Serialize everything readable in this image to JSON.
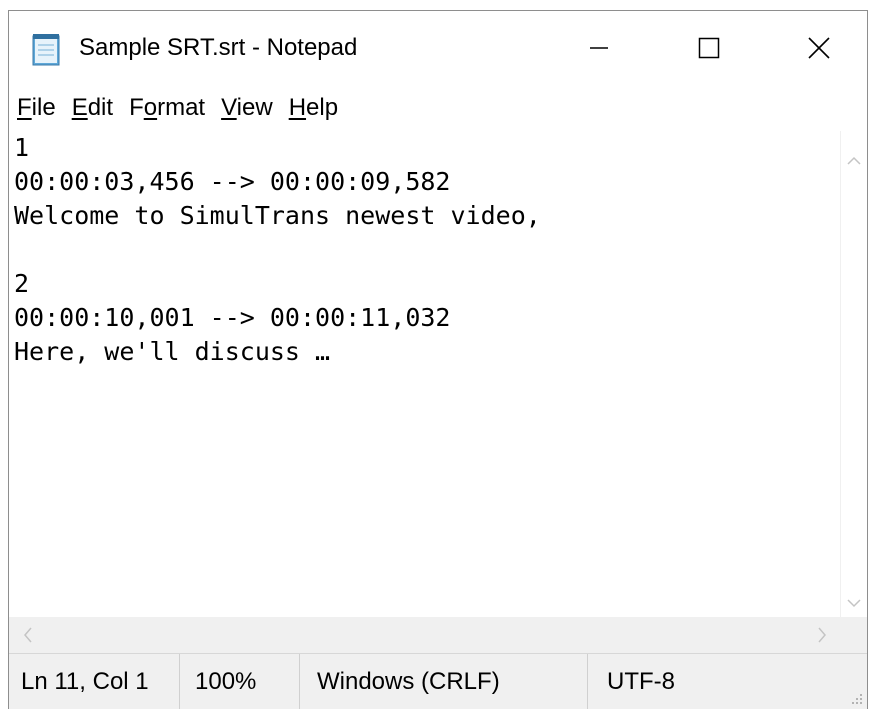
{
  "window": {
    "title": "Sample SRT.srt - Notepad",
    "icon": "notepad-icon",
    "controls": [
      "minimize-icon",
      "maximize-icon",
      "close-icon"
    ]
  },
  "menu": {
    "items": [
      {
        "accel": "F",
        "rest": "ile"
      },
      {
        "accel": "E",
        "rest": "dit"
      },
      {
        "pre": "F",
        "accel": "o",
        "rest": "rmat"
      },
      {
        "accel": "V",
        "rest": "iew"
      },
      {
        "accel": "H",
        "rest": "elp"
      }
    ]
  },
  "editor": {
    "lines": [
      "1",
      "00:00:03,456 --> 00:00:09,582",
      "Welcome to SimulTrans newest video,",
      "",
      "2",
      "00:00:10,001 --> 00:00:11,032",
      "Here, we'll discuss …"
    ]
  },
  "status": {
    "position": "Ln 11, Col 1",
    "zoom": "100%",
    "line_ending": "Windows (CRLF)",
    "encoding": "UTF-8"
  }
}
